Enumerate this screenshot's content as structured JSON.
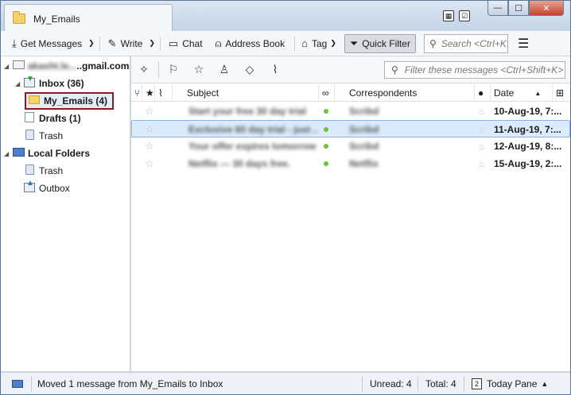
{
  "window": {
    "tab_title": "My_Emails",
    "title_icons": [
      "calendar-icon",
      "tasks-icon"
    ],
    "buttons": {
      "minimize": "—",
      "maximize": "☐",
      "close": "✕"
    }
  },
  "toolbar": {
    "get_messages": "Get Messages",
    "write": "Write",
    "chat": "Chat",
    "address_book": "Address Book",
    "tag": "Tag",
    "quick_filter": "Quick Filter",
    "search_placeholder": "Search <Ctrl+K>"
  },
  "folders": {
    "account": "akasht.le...",
    "account_suffix": "..gmail.com",
    "inbox": "Inbox (36)",
    "my_emails": "My_Emails (4)",
    "drafts": "Drafts (1)",
    "trash": "Trash",
    "local_folders": "Local Folders",
    "local_trash": "Trash",
    "outbox": "Outbox"
  },
  "filter": {
    "placeholder": "Filter these messages <Ctrl+Shift+K>"
  },
  "columns": {
    "subject": "Subject",
    "correspondents": "Correspondents",
    "date": "Date"
  },
  "messages": [
    {
      "subject": "Start your free 30 day trial",
      "from": "Scribd",
      "date": "10-Aug-19, 7:..."
    },
    {
      "subject": "Exclusive 60 day trial - just ...",
      "from": "Scribd",
      "date": "11-Aug-19, 7:..."
    },
    {
      "subject": "Your offer expires tomorrow",
      "from": "Scribd",
      "date": "12-Aug-19, 8:..."
    },
    {
      "subject": "Netflix — 30 days free.",
      "from": "Netflix",
      "date": "15-Aug-19, 2:..."
    }
  ],
  "status": {
    "message": "Moved 1 message from My_Emails to Inbox",
    "unread": "Unread: 4",
    "total": "Total: 4",
    "today_pane": "Today Pane",
    "today_day": "2"
  }
}
